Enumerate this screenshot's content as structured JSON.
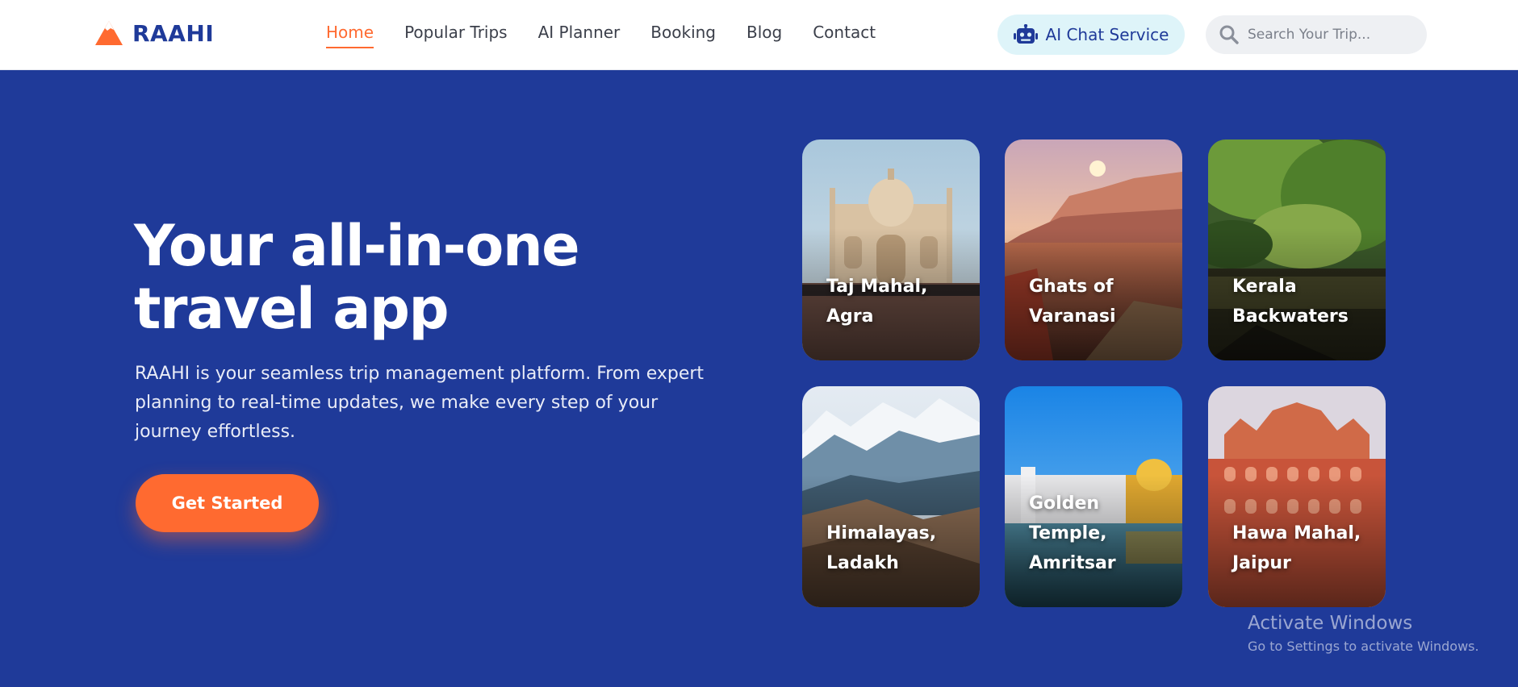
{
  "brand": {
    "name": "RAAHI",
    "accent": "#ff6a30",
    "primary": "#1f3a99"
  },
  "nav": {
    "items": [
      {
        "label": "Home",
        "active": true
      },
      {
        "label": "Popular Trips",
        "active": false
      },
      {
        "label": "AI Planner",
        "active": false
      },
      {
        "label": "Booking",
        "active": false
      },
      {
        "label": "Blog",
        "active": false
      },
      {
        "label": "Contact",
        "active": false
      }
    ],
    "chat_button": {
      "label": "AI Chat Service",
      "icon": "robot-icon"
    },
    "search": {
      "placeholder": "Search Your Trip...",
      "value": "",
      "icon": "search-icon"
    }
  },
  "hero": {
    "title_line1": "Your all-in-one",
    "title_line2": "travel app",
    "description": "RAAHI is your seamless trip management platform. From expert planning to real-time updates, we make every step of your journey effortless.",
    "cta_label": "Get Started"
  },
  "destinations": [
    {
      "label": "Taj Mahal,\nAgra"
    },
    {
      "label": "Ghats of\nVaranasi"
    },
    {
      "label": "Kerala\nBackwaters"
    },
    {
      "label": "Himalayas,\nLadakh"
    },
    {
      "label": "Golden\nTemple,\nAmritsar"
    },
    {
      "label": "Hawa Mahal,\nJaipur"
    }
  ],
  "watermark": {
    "title": "Activate Windows",
    "subtitle": "Go to Settings to activate Windows."
  }
}
